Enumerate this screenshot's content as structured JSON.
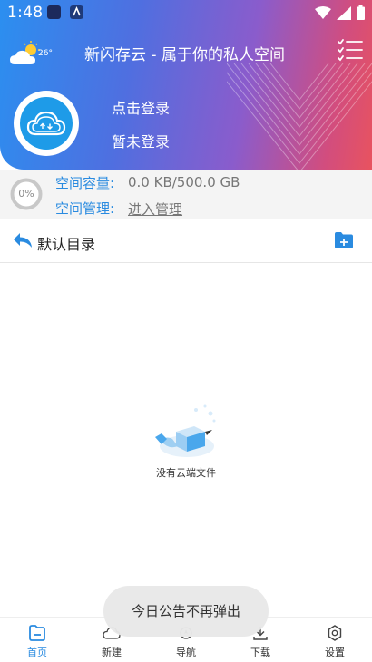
{
  "status_bar": {
    "time": "1:48"
  },
  "header": {
    "weather_temp": "26°",
    "title": "新闪存云 - 属于你的私人空间",
    "login_prompt": "点击登录",
    "login_status": "暂未登录"
  },
  "storage": {
    "usage_percent": "0%",
    "usage_fraction": 0,
    "capacity_label": "空间容量:",
    "capacity_value": "0.0 KB/500.0 GB",
    "manage_label": "空间管理:",
    "manage_link": "进入管理"
  },
  "directory": {
    "label": "默认目录"
  },
  "empty_state": {
    "text": "没有云端文件"
  },
  "toast": {
    "text": "今日公告不再弹出"
  },
  "bottom_nav": {
    "items": [
      {
        "label": "首页",
        "icon": "home-icon",
        "active": true
      },
      {
        "label": "新建",
        "icon": "cloud-icon",
        "active": false
      },
      {
        "label": "导航",
        "icon": "navigation-icon",
        "active": false
      },
      {
        "label": "下载",
        "icon": "download-icon",
        "active": false
      },
      {
        "label": "设置",
        "icon": "settings-icon",
        "active": false
      }
    ]
  },
  "colors": {
    "accent": "#2a8be0",
    "gradient_start": "#2b8ff0",
    "gradient_end": "#e8535f"
  }
}
